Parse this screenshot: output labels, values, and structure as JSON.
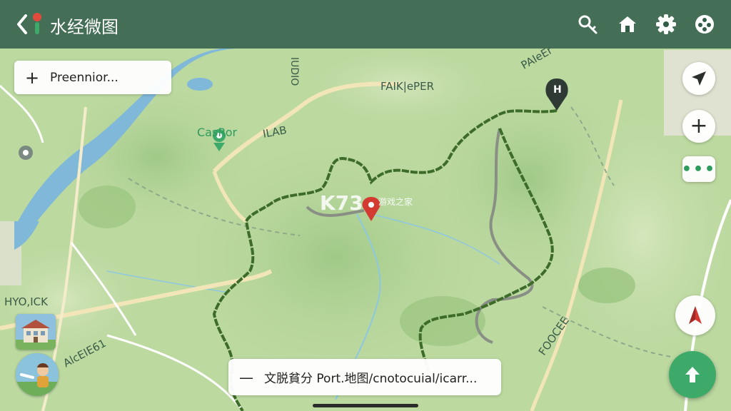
{
  "app": {
    "title": "水经微图"
  },
  "topbar": {
    "icons": [
      "back-arrow-icon",
      "search-icon",
      "home-icon",
      "settings-gear-icon",
      "gamepad-icon"
    ]
  },
  "search": {
    "label": "Preennior..."
  },
  "side_controls": {
    "locate": "navigation-arrow-icon",
    "zoom_in_label": "+",
    "more_label": "•••",
    "compass": "compass-icon",
    "fab": "up-arrow-icon"
  },
  "bottom_bar": {
    "label": "文脱貧分 Port.地图/cnotocuial/icarr..."
  },
  "map_labels": {
    "l1": "IUDIO",
    "l2": "FAIK|ePER",
    "l3": "PAIeEr",
    "l4": "CasRor",
    "l5": "ILAB",
    "l6": "HYO,ICK",
    "l7": "AlcEIE61",
    "l8": "FOOCEE",
    "l9": "H"
  },
  "watermark": {
    "main": "K73",
    "sub": "游戏之家"
  },
  "colors": {
    "topbar": "#305c48",
    "accent_green": "#3eaa6a",
    "trail": "#3d6b2a",
    "water": "#7fb8d8",
    "compass_red": "#d23a32"
  }
}
